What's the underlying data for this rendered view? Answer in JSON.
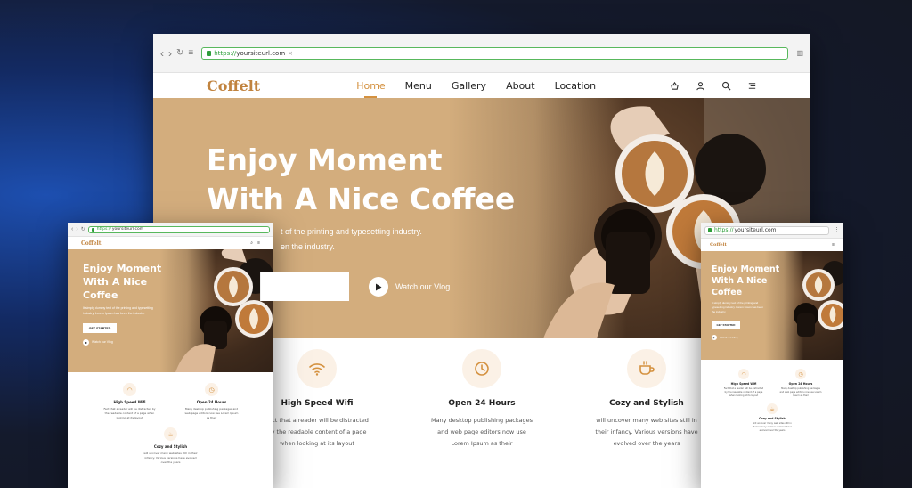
{
  "browser": {
    "url_scheme": "https://",
    "url_host": "yoursiteurl.com",
    "nav_glyphs": [
      "‹",
      "›",
      "↻",
      "≡"
    ]
  },
  "site": {
    "logo": "Coffelt",
    "menu": [
      "Home",
      "Menu",
      "Gallery",
      "About",
      "Location"
    ],
    "active_menu": "Home",
    "icons": [
      "basket-icon",
      "user-icon",
      "search-icon",
      "menu-icon"
    ]
  },
  "hero": {
    "title_line1": "Enjoy Moment",
    "title_line2": "With A Nice Coffee",
    "mobile_title_line1": "Enjoy Moment",
    "mobile_title_line2": "With A Nice",
    "mobile_title_line3": "Coffee",
    "desc_line1": "t of the printing and typesetting industry.",
    "desc_line2": "en the industry.",
    "mobile_desc": "It simply dummy text of the printing and typesetting industry. Lorem Ipsum has been the industry.",
    "cta_label": "GET STARTED",
    "vlog_label": "Watch our Vlog"
  },
  "features": [
    {
      "icon": "wifi-icon",
      "title": "High Speed Wifi",
      "text_line1": "Fact that a reader will be distracted",
      "text_line2": "by the readable content of a page",
      "text_line3": "when looking at its layout",
      "mobile_title": "High Speed Wifi",
      "mobile_text": "Fact that a reader will be distracted by the readable content of a page when looking at its layout"
    },
    {
      "icon": "clock-icon",
      "title": "Open 24 Hours",
      "text_line1": "Many desktop publishing packages",
      "text_line2": "and web page editors now use",
      "text_line3": "Lorem Ipsum as their",
      "mobile_title": "Open 24 Hours",
      "mobile_text": "Many desktop publishing packages and web page editors now use Lorem Ipsum as their"
    },
    {
      "icon": "coffee-cup-icon",
      "title": "Cozy and Stylish",
      "text_line1": "will uncover many web sites still in",
      "text_line2": "their infancy. Various versions have",
      "text_line3": "evolved over the years",
      "mobile_title": "Cozy and Stylish",
      "mobile_text": "will uncover many web sites still in their infancy. Various versions have evolved over the years"
    }
  ],
  "colors": {
    "accent": "#d4913f",
    "hero_tan": "#d3ad7d",
    "url_green": "#2e9e3a",
    "background": "#141620"
  }
}
